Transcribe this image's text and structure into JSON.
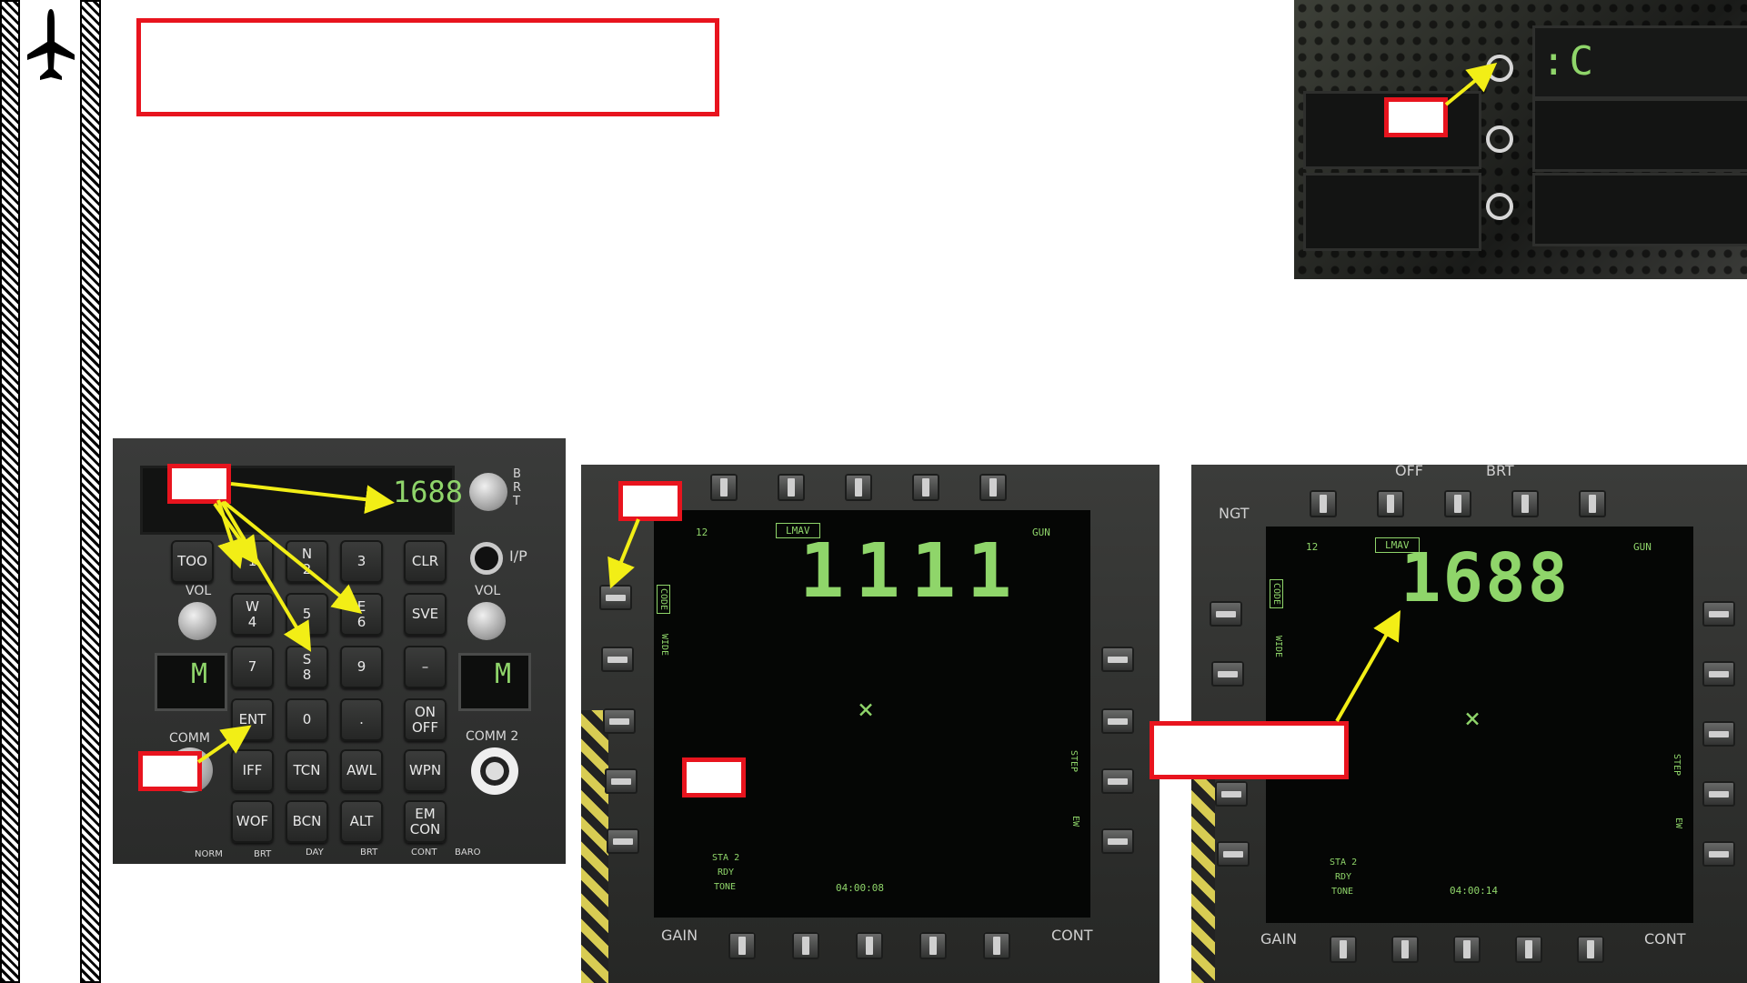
{
  "sidebar": {
    "icon": "aircraft-icon"
  },
  "ufc": {
    "scratchpad": "1688",
    "brt_label": "B\nR\nT",
    "ip_label": "I/P",
    "vol_label": "VOL",
    "comm1_label": "COMM",
    "comm2_label": "COMM 2",
    "comm_display": "M",
    "bottom_labels": [
      "NORM",
      "BRT",
      "DAY",
      "BRT",
      "CONT",
      "BARO"
    ],
    "keys": {
      "too": "TOO",
      "k1": "1",
      "k2_top": "N",
      "k2": "2",
      "k3": "3",
      "clr": "CLR",
      "k4_top": "W",
      "k4": "4",
      "k5": "5",
      "k6_top": "E",
      "k6": "6",
      "sve": "SVE",
      "k7": "7",
      "k8_top": "S",
      "k8": "8",
      "k9": "9",
      "dash": "–",
      "ent": "ENT",
      "k0": "0",
      "dot": ".",
      "onoff_top": "ON",
      "onoff": "OFF",
      "iff": "IFF",
      "tcn": "TCN",
      "awl": "AWL",
      "wpn": "WPN",
      "wof": "WOF",
      "bcn": "BCN",
      "alt": "ALT",
      "emcon_top": "EM",
      "emcon": "CON"
    }
  },
  "mfd_left": {
    "station_num": "12",
    "weapon": "LMAV",
    "gun": "GUN",
    "code_display": "1111",
    "left_labels": [
      "CODE",
      "WIDE"
    ],
    "right_labels": [
      "STEP",
      "EW"
    ],
    "status": [
      "STA 2",
      "RDY",
      "TONE"
    ],
    "time": "04:00:08",
    "gain": "GAIN",
    "cont": "CONT"
  },
  "mfd_right": {
    "off_label": "OFF",
    "brt_label": "BRT",
    "ngt_label": "NGT",
    "station_num": "12",
    "weapon": "LMAV",
    "gun": "GUN",
    "code_display": "1688",
    "left_labels": [
      "CODE",
      "WIDE"
    ],
    "right_labels": [
      "STEP",
      "EW"
    ],
    "status": [
      "STA 2",
      "RDY",
      "TONE"
    ],
    "time": "04:00:14",
    "gain": "GAIN",
    "cont": "CONT"
  },
  "option_display": {
    "text": ":C"
  },
  "colors": {
    "callout_red": "#e8141e",
    "arrow_yellow": "#f2ee16",
    "display_green": "#8fd56a"
  }
}
